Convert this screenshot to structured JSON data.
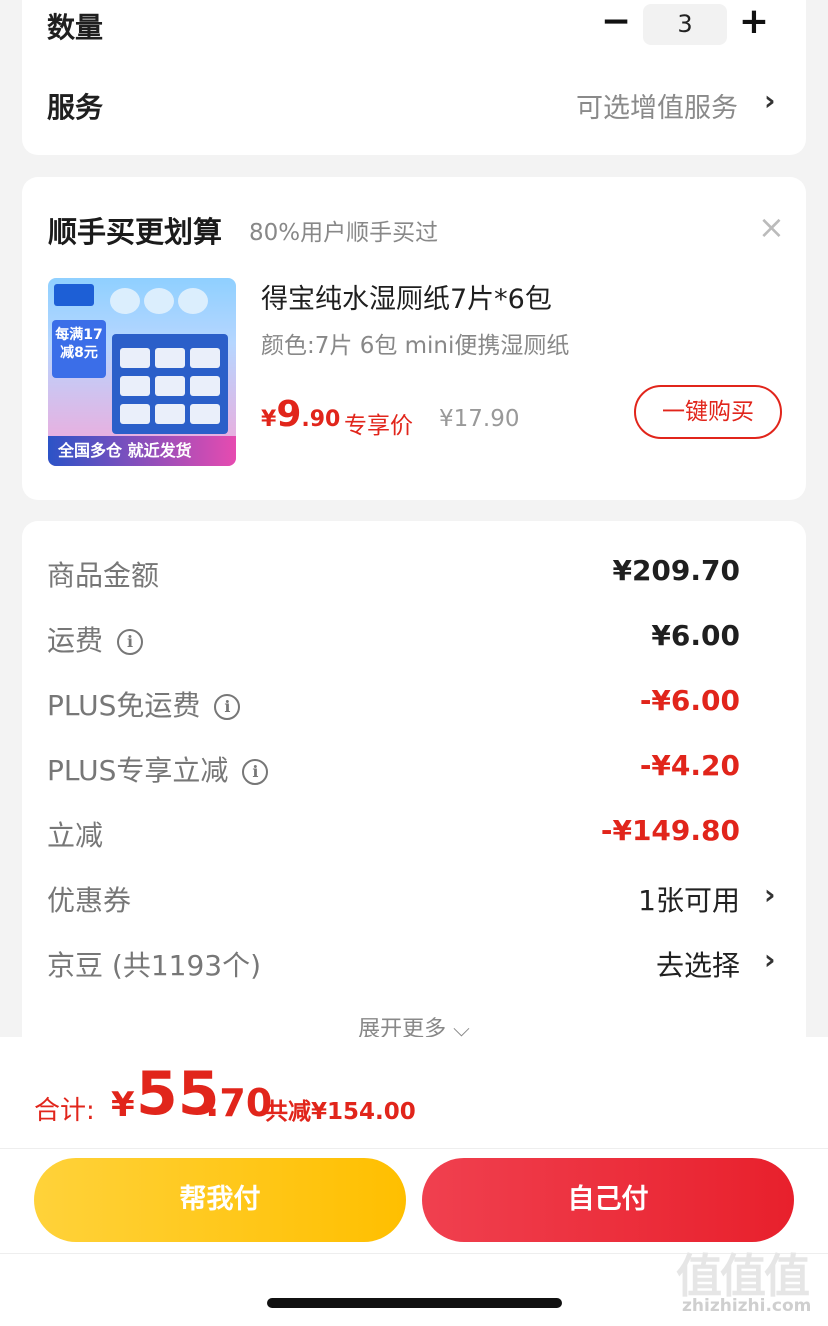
{
  "order_card": {
    "quantity_label": "数量",
    "quantity_minus": "−",
    "quantity_value": "3",
    "quantity_plus": "+",
    "service_label": "服务",
    "service_value": "可选增值服务",
    "chevron": "›"
  },
  "bundle": {
    "title": "顺手买更划算",
    "subtitle": "80%用户顺手买过",
    "close": "×",
    "product": {
      "image_badge": "每满17 减8元",
      "image_bottom_text": "全国多仓 就近发货",
      "name": "得宝纯水湿厕纸7片*6包",
      "spec": "颜色:7片 6包 mini便携湿厕纸",
      "price_currency": "¥",
      "price_int": "9",
      "price_dec": ".90",
      "price_tag": "专享价",
      "original_price": "¥17.90",
      "buy_button": "一键购买"
    }
  },
  "fees": {
    "rows": [
      {
        "label": "商品金额",
        "value": "¥209.70"
      },
      {
        "label": "运费",
        "value": "¥6.00"
      },
      {
        "label": "PLUS免运费",
        "value": "-¥6.00"
      },
      {
        "label": "PLUS专享立减",
        "value": "-¥4.20"
      },
      {
        "label": "立减",
        "value": "-¥149.80"
      },
      {
        "label": "优惠券",
        "value": "1张可用"
      },
      {
        "label": "京豆 (共1193个)",
        "value": "去选择"
      }
    ],
    "info_icon": "i",
    "chevron": "›",
    "expand_more": "展开更多 ⌵"
  },
  "summary": {
    "total_label": "合计:",
    "total_currency": "¥",
    "total_int": "55",
    "total_dec": ".70",
    "total_saved": "共减¥154.00"
  },
  "actions": {
    "help_pay": "帮我付",
    "self_pay": "自己付"
  },
  "watermark": {
    "logo": "值值值",
    "url": "zhizhizhi.com"
  },
  "colors": {
    "accent_red": "#e1251b",
    "help_button": "#ffc20e",
    "self_button": "#ea2b36"
  }
}
